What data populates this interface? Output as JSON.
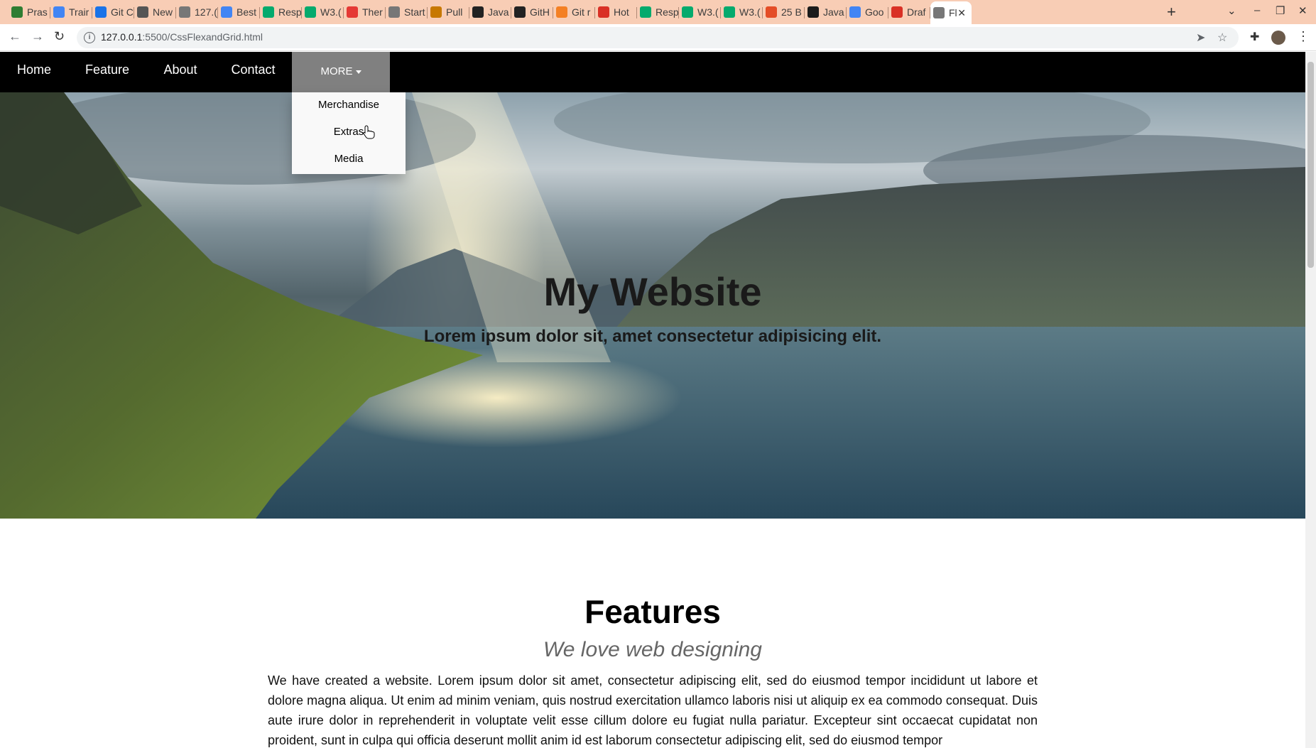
{
  "browser": {
    "tabs": [
      {
        "label": "Pras",
        "icon": "leaf-icon",
        "color": "#2e7d32"
      },
      {
        "label": "Trair",
        "icon": "doc-icon",
        "color": "#4285f4"
      },
      {
        "label": "Git C",
        "icon": "triangle-icon",
        "color": "#1a73e8"
      },
      {
        "label": "New",
        "icon": "globe-icon",
        "color": "#555555"
      },
      {
        "label": "127.(",
        "icon": "globe-icon",
        "color": "#777777"
      },
      {
        "label": "Best",
        "icon": "google-icon",
        "color": "#4285f4"
      },
      {
        "label": "Resp",
        "icon": "w3-icon",
        "color": "#04aa6d"
      },
      {
        "label": "W3.(",
        "icon": "w3-icon",
        "color": "#04aa6d"
      },
      {
        "label": "Ther",
        "icon": "wave-icon",
        "color": "#e53935"
      },
      {
        "label": "Start",
        "icon": "globe-icon",
        "color": "#777777"
      },
      {
        "label": "Pull",
        "icon": "bowl-icon",
        "color": "#c77800"
      },
      {
        "label": "Java",
        "icon": "github-icon",
        "color": "#222222"
      },
      {
        "label": "GitH",
        "icon": "github-icon",
        "color": "#222222"
      },
      {
        "label": "Git r",
        "icon": "stack-icon",
        "color": "#f48024"
      },
      {
        "label": "Hot",
        "icon": "gmail-icon",
        "color": "#d93025"
      },
      {
        "label": "Resp",
        "icon": "w3-icon",
        "color": "#04aa6d"
      },
      {
        "label": "W3.(",
        "icon": "w3-icon",
        "color": "#04aa6d"
      },
      {
        "label": "W3.(",
        "icon": "w3-icon",
        "color": "#04aa6d"
      },
      {
        "label": "25 B",
        "icon": "html5-icon",
        "color": "#e44d26"
      },
      {
        "label": "Java",
        "icon": "code-icon",
        "color": "#1b1b1b"
      },
      {
        "label": "Goo",
        "icon": "google-icon",
        "color": "#4285f4"
      },
      {
        "label": "Draf",
        "icon": "gmail-icon",
        "color": "#d93025"
      },
      {
        "label": "Fl",
        "icon": "globe-icon",
        "color": "#777777",
        "active": true
      }
    ],
    "new_tab": "+",
    "url_host": "127.0.0.1",
    "url_path": ":5500/CssFlexandGrid.html"
  },
  "page": {
    "nav": {
      "home": "Home",
      "feature": "Feature",
      "about": "About",
      "contact": "Contact",
      "more": "MORE",
      "dropdown": [
        "Merchandise",
        "Extras",
        "Media"
      ]
    },
    "hero": {
      "title": "My Website",
      "subtitle": "Lorem ipsum dolor sit, amet consectetur adipisicing elit."
    },
    "features": {
      "title": "Features",
      "subtitle": "We love web designing",
      "body": "We have created a website. Lorem ipsum dolor sit amet, consectetur adipiscing elit, sed do eiusmod tempor incididunt ut labore et dolore magna aliqua. Ut enim ad minim veniam, quis nostrud exercitation ullamco laboris nisi ut aliquip ex ea commodo consequat. Duis aute irure dolor in reprehenderit in voluptate velit esse cillum dolore eu fugiat nulla pariatur. Excepteur sint occaecat cupidatat non proident, sunt in culpa qui officia deserunt mollit anim id est laborum consectetur adipiscing elit, sed do eiusmod tempor"
    }
  },
  "colors": {
    "tab_strip": "#f8cdb5",
    "navbar": "#000000",
    "more_active": "#808080",
    "dropdown_bg": "#f9f9f9"
  }
}
